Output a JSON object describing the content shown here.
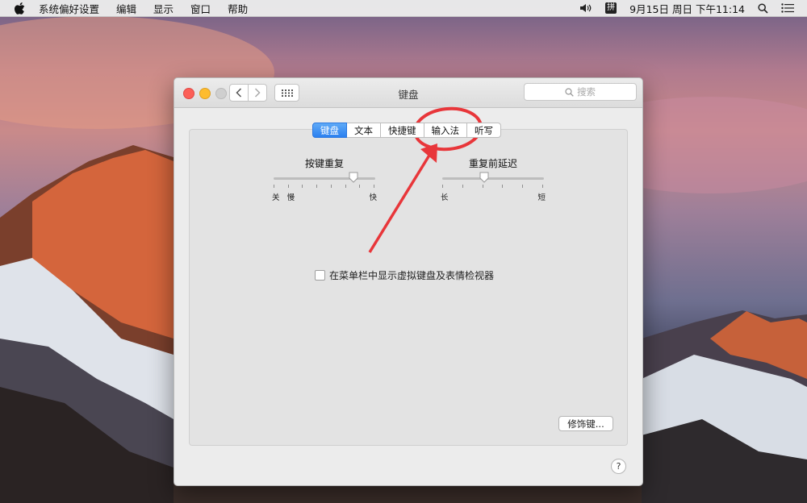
{
  "menubar": {
    "app_name": "系统偏好设置",
    "items": [
      "编辑",
      "显示",
      "窗口",
      "帮助"
    ],
    "ime": "拼",
    "clock": "9月15日 周日 下午11:14"
  },
  "window": {
    "title": "键盘",
    "search_placeholder": "搜索",
    "tabs": [
      {
        "label": "键盘",
        "active": true
      },
      {
        "label": "文本",
        "active": false
      },
      {
        "label": "快捷键",
        "active": false
      },
      {
        "label": "输入法",
        "active": false
      },
      {
        "label": "听写",
        "active": false
      }
    ],
    "key_repeat": {
      "title": "按键重复",
      "min_label_1": "关",
      "min_label_2": "慢",
      "max_label": "快",
      "value": 0.82
    },
    "delay_until_repeat": {
      "title": "重复前延迟",
      "min_label": "长",
      "max_label": "短",
      "value": 0.4
    },
    "show_viewer_checkbox": {
      "label": "在菜单栏中显示虚拟键盘及表情检视器",
      "checked": false
    },
    "modifier_button": "修饰键...",
    "help_button": "?"
  },
  "colors": {
    "tab_active": "#2b80f0",
    "annotation": "#e8363a",
    "close": "#fc5f57",
    "minimize": "#fdbc2e"
  }
}
